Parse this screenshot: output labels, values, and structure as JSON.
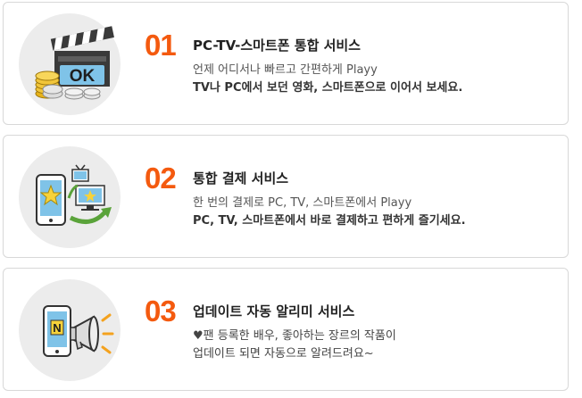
{
  "colors": {
    "accent": "#f45a0f",
    "card_border": "#d8d8d8",
    "icon_bg": "#ececec"
  },
  "services": [
    {
      "number": "01",
      "title": "PC-TV-스마트폰 통합 서비스",
      "line1": "언제 어디서나 빠르고 간편하게 Playy",
      "line2": "TV나 PC에서 보던 영화, 스마트폰으로 이어서 보세요.",
      "icon": "clapperboard-ok-coins-icon",
      "icon_text": "OK"
    },
    {
      "number": "02",
      "title": "통합 결제 서비스",
      "line1": "한 번의 결제로 PC, TV, 스마트폰에서 Playy",
      "line2": "PC, TV, 스마트폰에서 바로 결제하고 편하게 즐기세요.",
      "icon": "smartphone-tv-sync-icon"
    },
    {
      "number": "03",
      "title": "업데이트 자동 알리미 서비스",
      "line1": "♥팬 등록한 배우, 좋아하는 장르의 작품이",
      "line2": "업데이트 되면 자동으로 알려드려요~",
      "icon": "phone-megaphone-icon",
      "icon_text": "N"
    }
  ]
}
